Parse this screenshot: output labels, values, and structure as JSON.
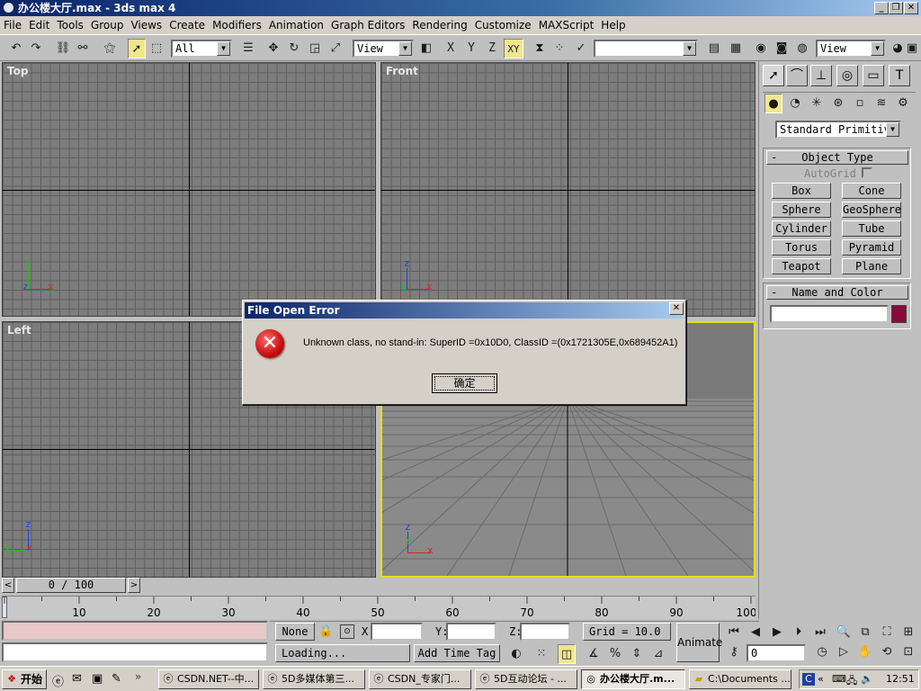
{
  "window": {
    "title": "办公楼大厅.max - 3ds max 4"
  },
  "menu": [
    "File",
    "Edit",
    "Tools",
    "Group",
    "Views",
    "Create",
    "Modifiers",
    "Animation",
    "Graph Editors",
    "Rendering",
    "Customize",
    "MAXScript",
    "Help"
  ],
  "toolbar": {
    "selection_filter": "All",
    "ref_coord": "View",
    "named_selection": "",
    "right_view": "View",
    "axis_x": "X",
    "axis_y": "Y",
    "axis_z": "Z",
    "axis_xy": "XY"
  },
  "viewports": {
    "top": "Top",
    "front": "Front",
    "left": "Left"
  },
  "axis_labels": {
    "x": "x",
    "y": "y",
    "z": "z"
  },
  "command_panel": {
    "category": "Standard Primitiv",
    "object_type_title": "Object Type",
    "autogrid": "AutoGrid",
    "buttons": [
      "Box",
      "Cone",
      "Sphere",
      "GeoSphere",
      "Cylinder",
      "Tube",
      "Torus",
      "Pyramid",
      "Teapot",
      "Plane"
    ],
    "name_color_title": "Name and Color",
    "name_value": "",
    "object_color": "#8b0a3a"
  },
  "timeline": {
    "slider": "0 / 100",
    "ticks": [
      "0",
      "10",
      "20",
      "30",
      "40",
      "50",
      "60",
      "70",
      "80",
      "90",
      "100"
    ]
  },
  "status": {
    "selection": "None",
    "x_label": "X:",
    "y_label": "Y:",
    "z_label": "Z:",
    "x_value": "",
    "y_value": "",
    "z_value": "",
    "grid": "Grid = 10.0",
    "prompt": "Loading...",
    "add_time_tag": "Add Time Tag",
    "animate": "Animate",
    "frame": "0"
  },
  "dialog": {
    "title": "File Open Error",
    "message": "Unknown class, no stand-in: SuperID =0x10D0, ClassID =(0x1721305E,0x689452A1)",
    "ok": "确定"
  },
  "taskbar": {
    "start": "开始",
    "tasks": [
      "CSDN.NET--中...",
      "5D多媒体第三...",
      "CSDN_专家门...",
      "5D互动论坛 - ...",
      "办公楼大厅.m...",
      "C:\\Documents ..."
    ],
    "clock": "12:51"
  }
}
